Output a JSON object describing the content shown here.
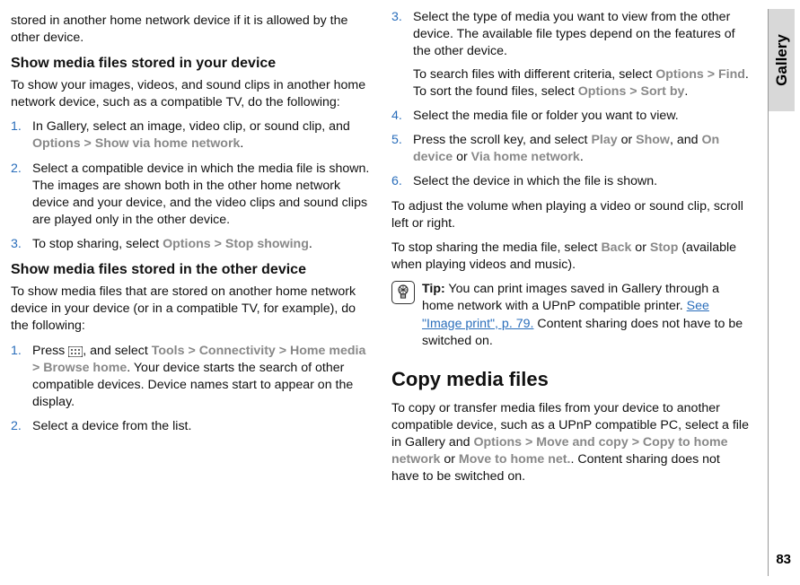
{
  "sideTab": "Gallery",
  "pageNumber": "83",
  "left": {
    "intro": "stored in another home network device if it is allowed by the other device.",
    "h1": "Show media files stored in your device",
    "p1": "To show your images, videos, and sound clips in another home network device, such as a compatible TV, do the following:",
    "step1_a": "In Gallery, select an image, video clip, or sound clip, and ",
    "step1_opt": "Options",
    "step1_gt": " > ",
    "step1_show": "Show via home network",
    "step1_end": ".",
    "step2": "Select a compatible device in which the media file is shown. The images are shown both in the other home network device and your device, and the video clips and sound clips are played only in the other device.",
    "step3_a": "To stop sharing, select ",
    "step3_opt": "Options",
    "step3_gt": " > ",
    "step3_stop": "Stop showing",
    "step3_end": ".",
    "h2": "Show media files stored in the other device",
    "p2": "To show media files that are stored on another home network device in your device (or in a compatible TV, for example), do the following:",
    "b1_a": "Press ",
    "b1_b": ", and select ",
    "b1_tools": "Tools",
    "b1_gt": " > ",
    "b1_conn": "Connectivity",
    "b1_home": "Home media",
    "b1_browse": "Browse home",
    "b1_c": ". Your device starts the search of other compatible devices. Device names start to appear on the display.",
    "b2": "Select a device from the list."
  },
  "right": {
    "r3_a": "Select the type of media you want to view from the other device. The available file types depend on the features of the other device.",
    "r3_b_a": "To search files with different criteria, select ",
    "r3_opt": "Options",
    "r3_gt": " > ",
    "r3_find": "Find",
    "r3_b_b": ". To sort the found files, select ",
    "r3_sort": "Sort by",
    "r3_end": ".",
    "r4": "Select the media file or folder you want to view.",
    "r5_a": "Press the scroll key, and select ",
    "r5_play": "Play",
    "r5_or": " or ",
    "r5_show": "Show",
    "r5_and": ", and ",
    "r5_ondev": "On device",
    "r5_or2": " or ",
    "r5_via": "Via home network",
    "r5_end": ".",
    "r6": "Select the device in which the file is shown.",
    "p_adjust": "To adjust the volume when playing a video or sound clip, scroll left or right.",
    "p_stop_a": "To stop sharing the media file, select ",
    "p_back": "Back",
    "p_stop_or": " or ",
    "p_stop": "Stop",
    "p_stop_b": " (available when playing videos and music).",
    "tip_label": "Tip:",
    "tip_a": " You can print images saved in Gallery through a home network with a UPnP compatible printer. ",
    "tip_link": "See \"Image print\", p. 79.",
    "tip_b": " Content sharing does not have to be switched on.",
    "copy_h": "Copy media files",
    "copy_a": "To copy or transfer media files from your device to another compatible device, such as a UPnP compatible PC, select a file in Gallery and ",
    "copy_opt": "Options",
    "copy_gt": " > ",
    "copy_mac": "Move and copy",
    "copy_cth": "Copy to home network",
    "copy_or": " or ",
    "copy_mth": "Move to home net.",
    "copy_b": ". Content sharing does not have to be switched on."
  }
}
